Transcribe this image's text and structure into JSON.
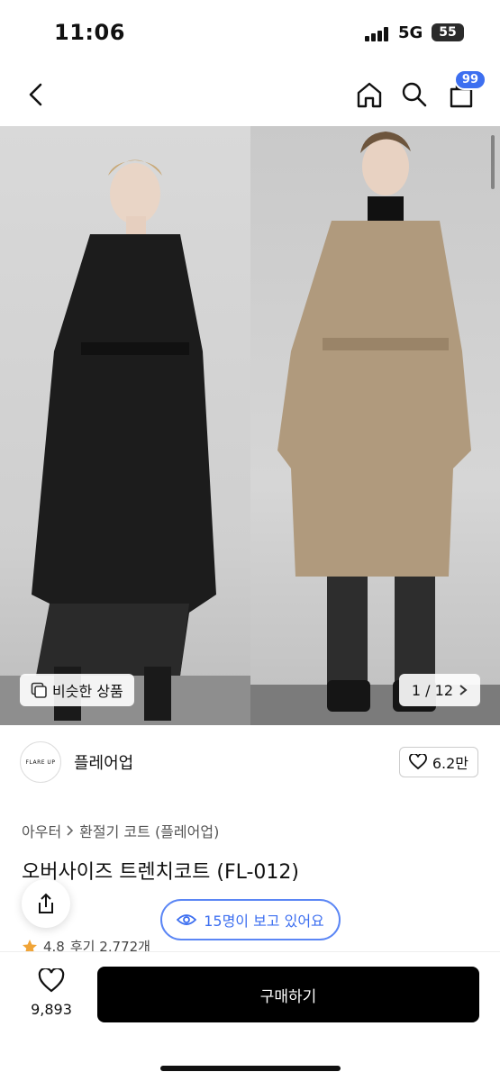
{
  "status_bar": {
    "time": "11:06",
    "network": "5G",
    "battery": "55"
  },
  "nav": {
    "cart_badge": "99"
  },
  "hero": {
    "similar_label": "비슷한 상품",
    "page_indicator": "1 / 12"
  },
  "brand": {
    "logo_text": "FLARE UP",
    "name": "플레어업",
    "likes": "6.2만"
  },
  "breadcrumb": {
    "category": "아우터",
    "subcategory": "환절기 코트 (플레어업)"
  },
  "product": {
    "title": "오버사이즈 트렌치코트 (FL-012)",
    "rating": "4.8",
    "reviews": "후기 2,772개"
  },
  "viewers": {
    "label": "15명이 보고 있어요"
  },
  "bottom": {
    "wish_count": "9,893",
    "buy_label": "구매하기"
  },
  "colors": {
    "accent": "#3d6ff0",
    "buy_bg": "#000000",
    "coat_black": "#1c1c1c",
    "coat_beige": "#b09a7d"
  },
  "icons": [
    "back-icon",
    "home-icon",
    "search-icon",
    "cart-icon",
    "similar-icon",
    "chevron-right-icon",
    "heart-icon",
    "share-icon",
    "eye-icon",
    "star-icon"
  ]
}
